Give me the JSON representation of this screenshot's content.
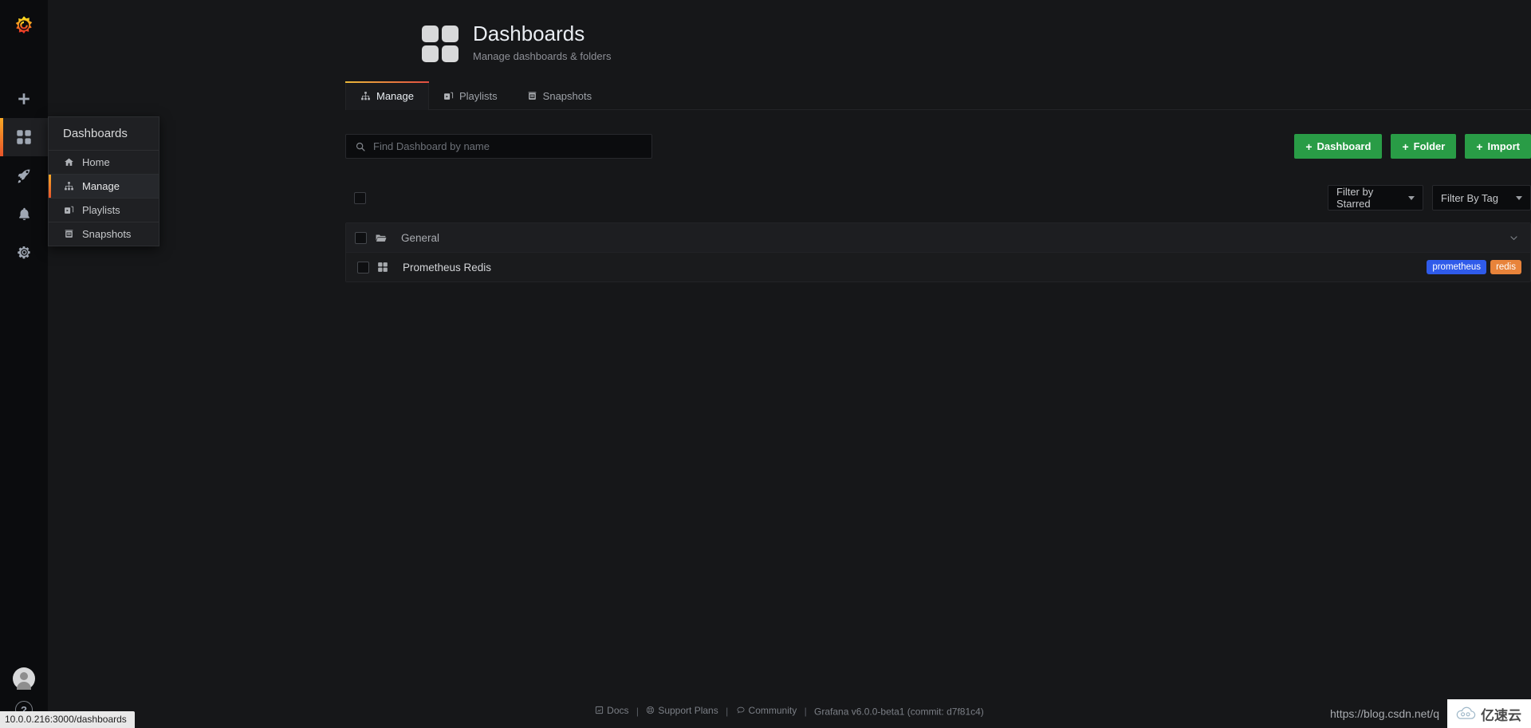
{
  "browser": {
    "status_url": "10.0.0.216:3000/dashboards"
  },
  "watermark": {
    "url": "https://blog.csdn.net/q",
    "badge_text": "亿速云"
  },
  "sidebar": {
    "logo": "grafana-logo",
    "items": [
      {
        "label": "Create",
        "icon": "plus-icon",
        "active": false
      },
      {
        "label": "Dashboards",
        "icon": "dashboards-icon",
        "active": true
      },
      {
        "label": "Explore",
        "icon": "rocket-icon",
        "active": false
      },
      {
        "label": "Alerting",
        "icon": "bell-icon",
        "active": false
      },
      {
        "label": "Configuration",
        "icon": "gear-icon",
        "active": false
      }
    ],
    "bottom": [
      {
        "label": "User profile",
        "icon": "avatar-icon"
      },
      {
        "label": "Help",
        "icon": "help-icon"
      }
    ]
  },
  "nav_dropdown": {
    "title": "Dashboards",
    "items": [
      {
        "label": "Home",
        "icon": "home-icon",
        "active": false
      },
      {
        "label": "Manage",
        "icon": "sitemap-icon",
        "active": true
      },
      {
        "label": "Playlists",
        "icon": "playlist-icon",
        "active": false
      },
      {
        "label": "Snapshots",
        "icon": "snapshot-icon",
        "active": false
      }
    ]
  },
  "header": {
    "title": "Dashboards",
    "subtitle": "Manage dashboards & folders",
    "icon": "dashboards-grid-icon"
  },
  "tabs": [
    {
      "label": "Manage",
      "icon": "sitemap-icon",
      "active": true
    },
    {
      "label": "Playlists",
      "icon": "playlist-icon",
      "active": false
    },
    {
      "label": "Snapshots",
      "icon": "snapshot-icon",
      "active": false
    }
  ],
  "toolbar": {
    "search_placeholder": "Find Dashboard by name",
    "search_value": "",
    "search_icon": "search-icon",
    "buttons": [
      {
        "label": "Dashboard",
        "icon": "plus-icon"
      },
      {
        "label": "Folder",
        "icon": "plus-icon"
      },
      {
        "label": "Import",
        "icon": "plus-icon"
      }
    ]
  },
  "filters": {
    "starred": {
      "label": "Filter by Starred",
      "selected": "Filter by Starred"
    },
    "tag": {
      "label": "Filter By Tag",
      "selected": "Filter By Tag"
    }
  },
  "list": {
    "folder": {
      "name": "General",
      "icon": "folder-open-icon",
      "expand_icon": "chevron-down-icon",
      "checked": false
    },
    "dashboards": [
      {
        "name": "Prometheus Redis",
        "icon": "dashboard-grid-icon",
        "checked": false,
        "tags": [
          {
            "label": "prometheus",
            "color": "#2f5bea"
          },
          {
            "label": "redis",
            "color": "#e8833a"
          }
        ]
      }
    ]
  },
  "footer": {
    "links": [
      {
        "label": "Docs",
        "icon": "doc-icon"
      },
      {
        "label": "Support Plans",
        "icon": "lifebuoy-icon"
      },
      {
        "label": "Community",
        "icon": "comment-icon"
      }
    ],
    "version": "Grafana v6.0.0-beta1 (commit: d7f81c4)",
    "separator": "|"
  },
  "colors": {
    "accent_start": "#eab839",
    "accent_end": "#e24d42",
    "green_button": "#299c46",
    "page_bg": "#161719",
    "rail_bg": "#0b0c0e"
  }
}
